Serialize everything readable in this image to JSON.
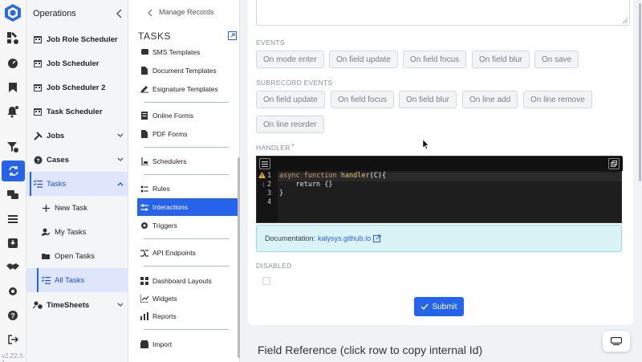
{
  "app": {
    "version": "v2.22.3-1"
  },
  "operations": {
    "title": "Operations",
    "items": [
      {
        "label": "Job Role Scheduler",
        "icon": "calendar-icon"
      },
      {
        "label": "Job Scheduler",
        "icon": "calendar-icon"
      },
      {
        "label": "Job Scheduler 2",
        "icon": "calendar-icon"
      },
      {
        "label": "Task Scheduler",
        "icon": "calendar-icon"
      },
      {
        "label": "Jobs",
        "icon": "tools-icon"
      },
      {
        "label": "Cases",
        "icon": "cases-icon"
      },
      {
        "label": "Tasks",
        "icon": "checklist-icon"
      },
      {
        "label": "New Task",
        "icon": "plus-icon"
      },
      {
        "label": "My Tasks",
        "icon": "user-edit-icon"
      },
      {
        "label": "Open Tasks",
        "icon": "folder-open-icon"
      },
      {
        "label": "All Tasks",
        "icon": "checklist-icon"
      },
      {
        "label": "TimeSheets",
        "icon": "user-clock-icon"
      }
    ]
  },
  "tasks_panel": {
    "breadcrumb": "Manage Records",
    "title": "TASKS",
    "items": [
      {
        "label": "SMS Templates",
        "icon": "sms-icon"
      },
      {
        "label": "Document Templates",
        "icon": "document-icon"
      },
      {
        "label": "Esignature Templates",
        "icon": "signature-icon"
      },
      {
        "label": "Online Forms",
        "icon": "form-icon"
      },
      {
        "label": "PDF Forms",
        "icon": "pdf-icon"
      },
      {
        "label": "Schedulers",
        "icon": "scheduler-icon"
      },
      {
        "label": "Rules",
        "icon": "rules-icon"
      },
      {
        "label": "Interactions",
        "icon": "interactions-icon"
      },
      {
        "label": "Triggers",
        "icon": "trigger-icon"
      },
      {
        "label": "API Endpoints",
        "icon": "api-icon"
      },
      {
        "label": "Dashboard Layouts",
        "icon": "dashboard-icon"
      },
      {
        "label": "Widgets",
        "icon": "widgets-icon"
      },
      {
        "label": "Reports",
        "icon": "reports-icon"
      },
      {
        "label": "Import",
        "icon": "import-icon"
      }
    ]
  },
  "form": {
    "events_label": "EVENTS",
    "events": [
      "On mode enter",
      "On field update",
      "On field focus",
      "On field blur",
      "On save"
    ],
    "subrecord_label": "SUBRECORD EVENTS",
    "subrecord_events": [
      "On field update",
      "On field focus",
      "On field blur",
      "On line add",
      "On line remove",
      "On line reorder"
    ],
    "handler_label": "HANDLER",
    "handler_required": "*",
    "code_lines": [
      {
        "n": "1",
        "kw": "async",
        "kw2": "function",
        "fn": "handler",
        "rest": "(C){"
      },
      {
        "n": "2",
        "text": "    return {}"
      },
      {
        "n": "3",
        "text": "}"
      },
      {
        "n": "4",
        "text": ""
      }
    ],
    "doc_label": "Documentation:",
    "doc_link": "kalysys.github.io",
    "disabled_label": "DISABLED",
    "submit_label": "Submit",
    "field_reference": "Field Reference (click row to copy internal Id)"
  },
  "colors": {
    "accent": "#2563eb",
    "doc_bg": "#d9f3f7"
  }
}
